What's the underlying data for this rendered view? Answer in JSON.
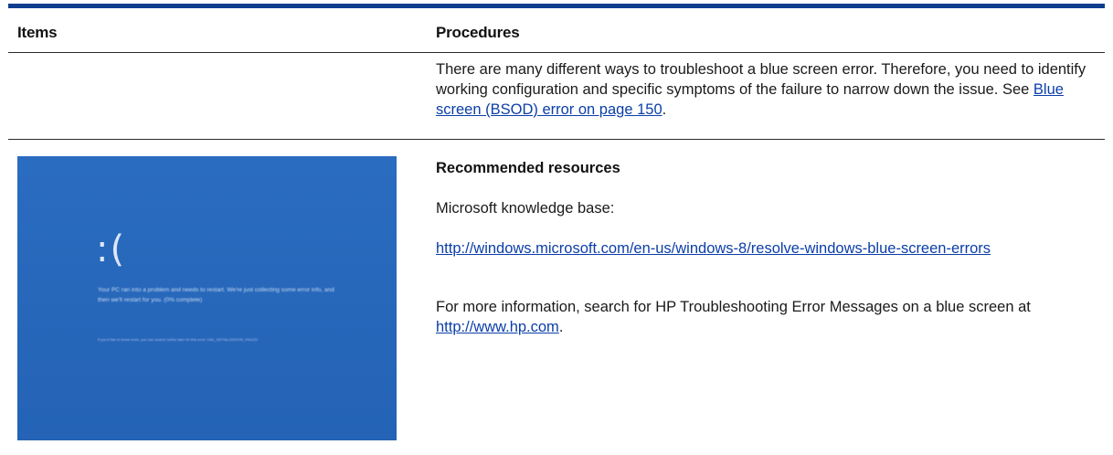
{
  "table": {
    "headers": {
      "items": "Items",
      "procedures": "Procedures"
    },
    "row1": {
      "text": "There are many different ways to troubleshoot a blue screen error. Therefore, you need to identify working configuration and specific symptoms of the failure to narrow down the issue. See ",
      "link": "Blue screen (BSOD) error on page 150",
      "after_link": "."
    },
    "row2": {
      "resources_title": "Recommended resources",
      "kb_label": "Microsoft knowledge base:",
      "kb_url": "http://windows.microsoft.com/en-us/windows-8/resolve-windows-blue-screen-errors",
      "more_info_prefix": "For more information, search for HP Troubleshooting Error Messages on a blue screen at ",
      "more_info_link": "http://www.hp.com",
      "more_info_suffix": ".",
      "bsod_image": {
        "face": ":(",
        "message": "Your PC ran into a problem and needs to restart. We're just collecting some error info, and then we'll restart for you. (0% complete)",
        "stop_line": "If you'd like to know more, you can search online later for this error: HAL_INITIALIZATION_FAILED"
      }
    }
  },
  "colors": {
    "top_rule": "#0e3d8f",
    "link": "#0b3ea8",
    "bsod_blue": "#2463b5"
  }
}
